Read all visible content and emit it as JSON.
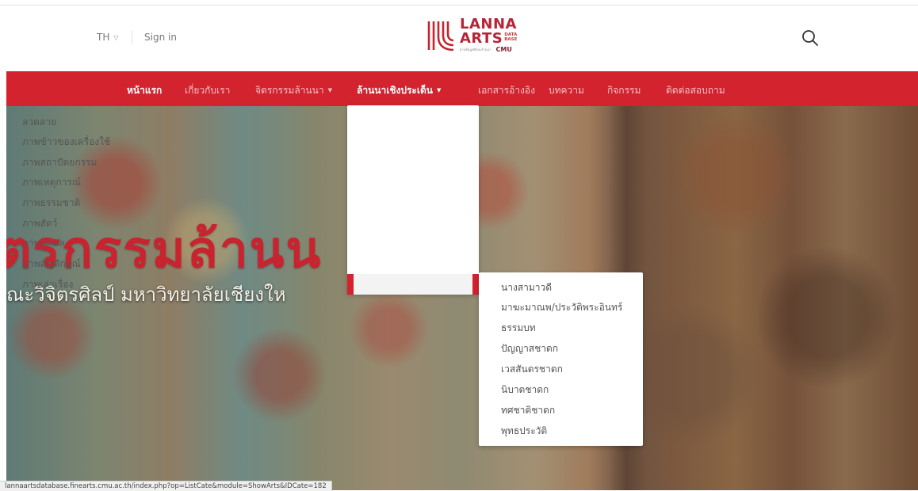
{
  "header": {
    "language": "TH",
    "sign_in": "Sign in",
    "logo": {
      "line1": "LANNA",
      "line2": "ARTS",
      "database": [
        "DATA",
        "BASE"
      ],
      "tagline": "ฐานข้อมูลศิลปะล้านนา",
      "cmu": "CMU"
    },
    "search_icon": "search-icon"
  },
  "nav": {
    "items": [
      {
        "label": "หน้าแรก",
        "active": true,
        "has_caret": false
      },
      {
        "label": "เกี่ยวกับเรา",
        "has_caret": false
      },
      {
        "label": "จิตรกรรมล้านนา",
        "has_caret": true
      },
      {
        "label": "ล้านนาเชิงประเด็น",
        "active": true,
        "has_caret": true
      },
      {
        "label": "เอกสารอ้างอิง",
        "has_caret": false
      },
      {
        "label": "บทความ",
        "has_caret": false
      },
      {
        "label": "กิจกรรม",
        "has_caret": false
      },
      {
        "label": "ติดต่อสอบถาม",
        "has_caret": false
      }
    ],
    "caret": "▼"
  },
  "hero": {
    "title": "ตรกรรมล้านน",
    "subtitle": "ณะวิจิตรศิลป์  มหาวิทยาลัยเชียงให"
  },
  "dropdown": {
    "items": [
      "ลวดลาย",
      "ภาพข้าวของเครื่องใช้",
      "ภาพสถาปัตยกรรม",
      "ภาพเหตุการณ์",
      "ภาพธรรมชาติ",
      "ภาพสัตว์",
      "ภาพบุคคล",
      "ภาพสัญลักษณ์",
      "ภาพเล่าเรื่อง"
    ],
    "active_index": 8
  },
  "submenu": {
    "items": [
      "นางสามาวดี",
      "มาฆะมาณพ/ประวัติพระอินทร์",
      "ธรรมบท",
      "ปัญญาสชาดก",
      "เวสสันดรชาดก",
      "นิบาตชาดก",
      "ทศชาติชาดก",
      "พุทธประวัติ"
    ]
  },
  "status_bar": {
    "url": "lannaartsdatabase.finearts.cmu.ac.th/index.php?op=ListCate&module=ShowArts&IDCate=182"
  },
  "colors": {
    "brand_red": "#d2232f",
    "logo_red": "#b52536"
  }
}
